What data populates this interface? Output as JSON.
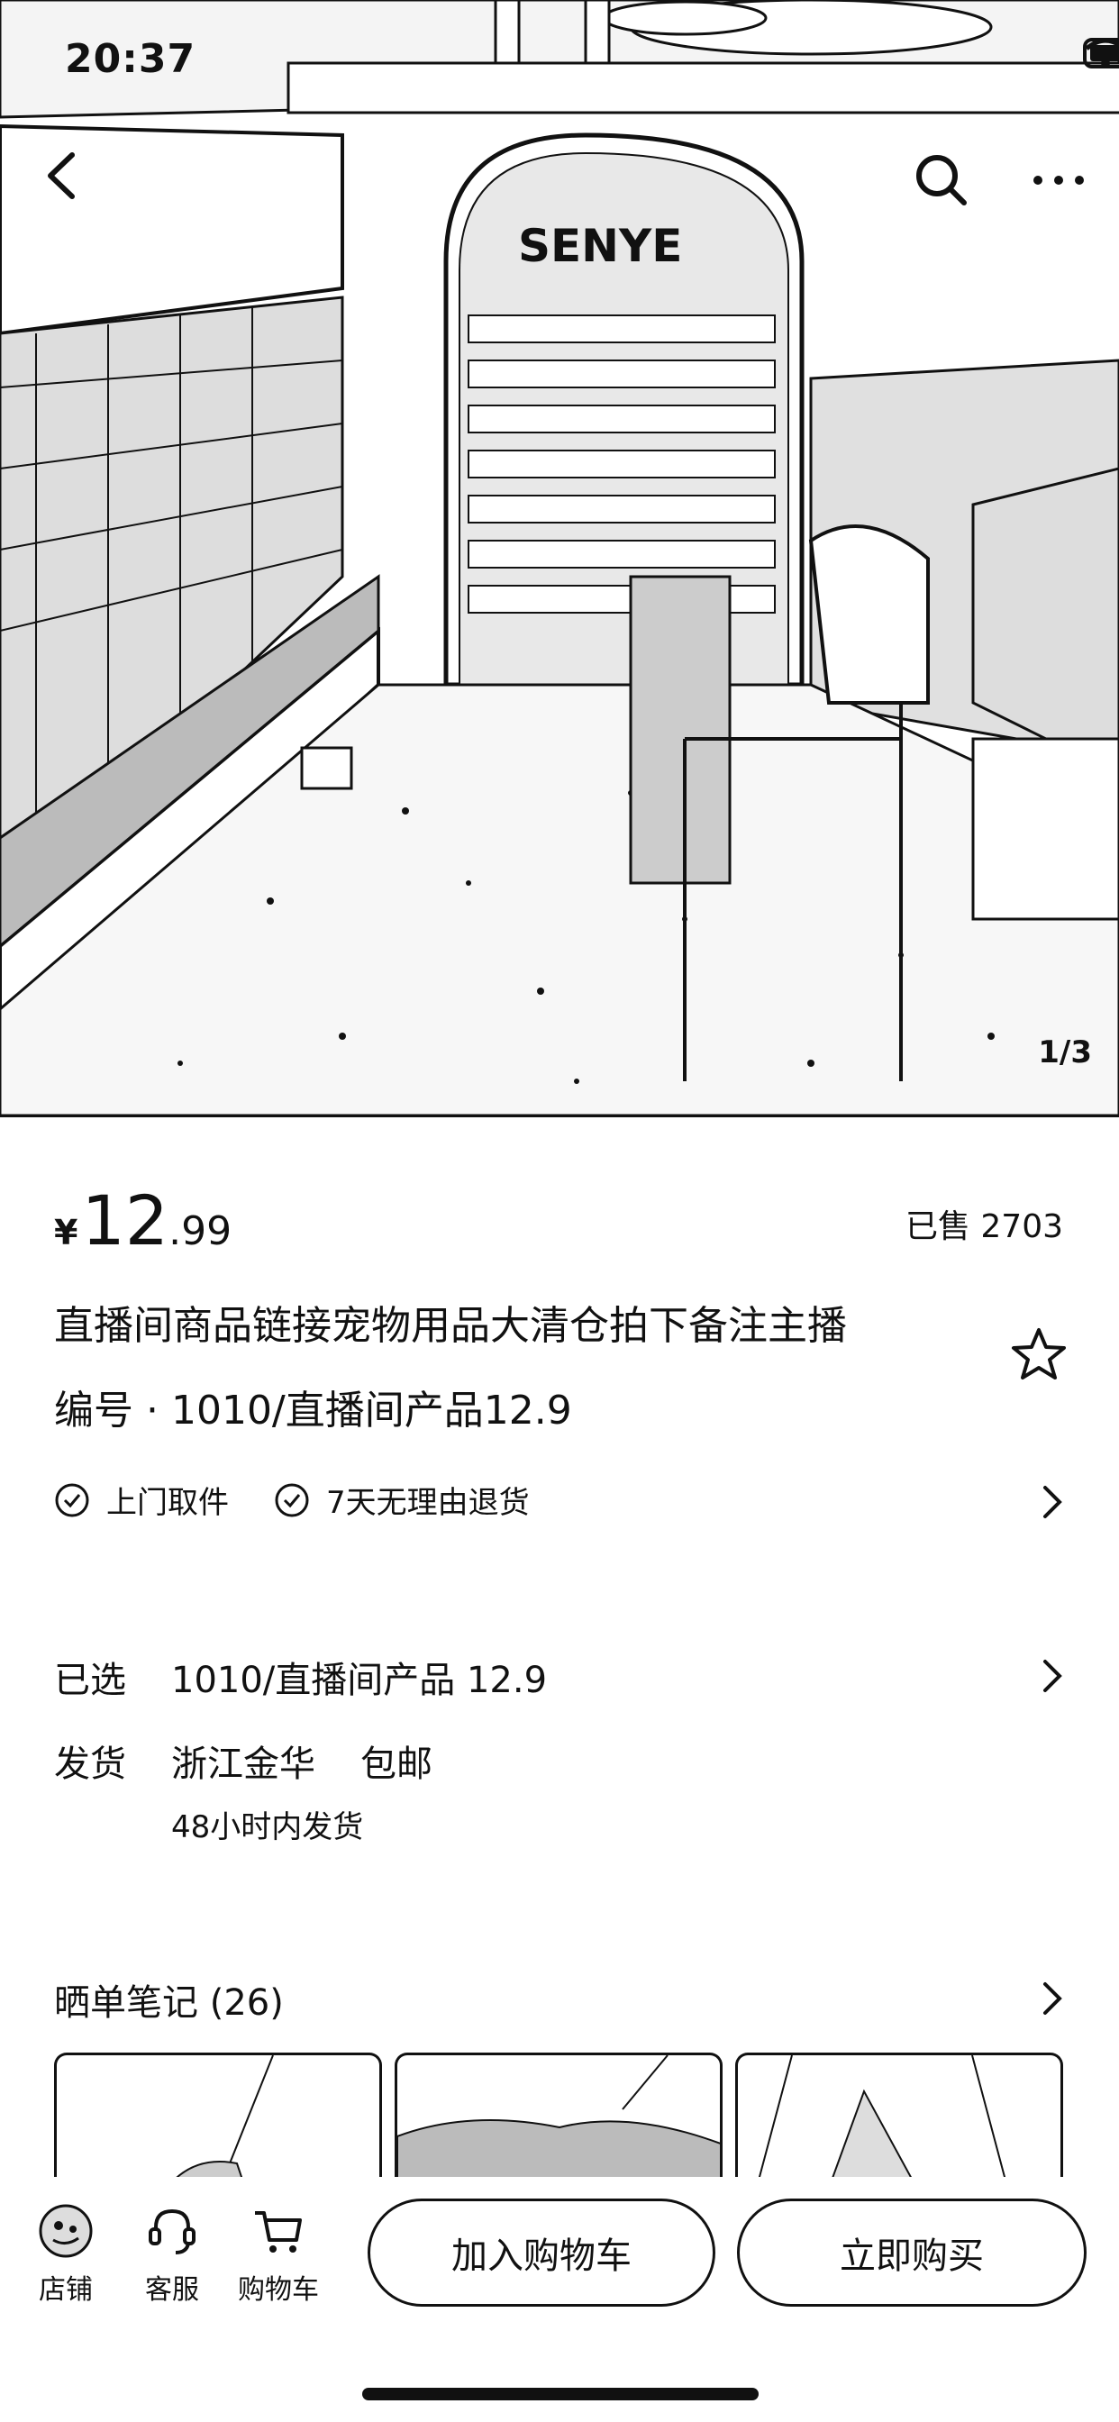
{
  "status_bar": {
    "time": "20:37"
  },
  "hero": {
    "image_counter": "1/3",
    "store_sign": "SENYE"
  },
  "product": {
    "currency": "¥",
    "price_int": "12",
    "price_dec": ".99",
    "sold": "已售 2703",
    "title_line1": "直播间商品链接宠物用品大清仓拍下备注主播",
    "title_line2": "编号 · 1010/直播间产品12.9"
  },
  "services": [
    {
      "label": "上门取件"
    },
    {
      "label": "7天无理由退货"
    }
  ],
  "selected": {
    "key": "已选",
    "value": "1010/直播间产品 12.9"
  },
  "shipping": {
    "key": "发货",
    "origin": "浙江金华",
    "free": "包邮",
    "time": "48小时内发货"
  },
  "notes": {
    "title": "晒单笔记 (26)"
  },
  "bottom": {
    "tabs": [
      {
        "label": "店铺"
      },
      {
        "label": "客服"
      },
      {
        "label": "购物车"
      }
    ],
    "add_cart": "加入购物车",
    "buy_now": "立即购买"
  },
  "icons": [
    "back-icon",
    "search-icon",
    "more-icon",
    "star-icon",
    "check-icon",
    "chevron-right-icon",
    "store-icon",
    "headset-icon",
    "cart-icon"
  ]
}
